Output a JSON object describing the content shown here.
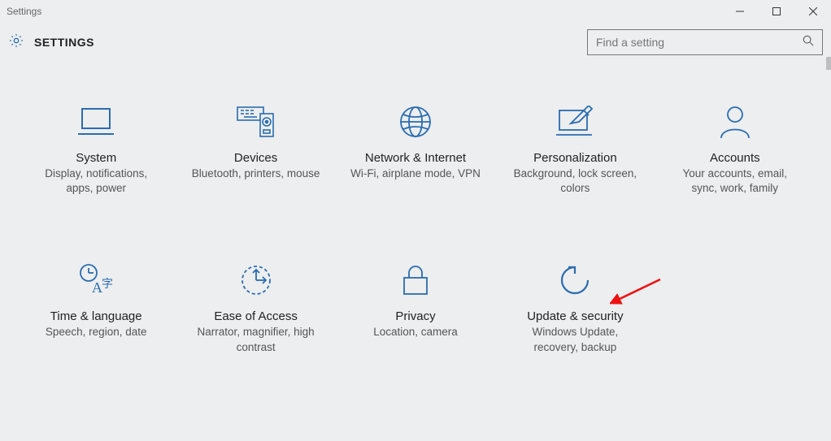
{
  "window": {
    "title": "Settings"
  },
  "header": {
    "title": "SETTINGS"
  },
  "search": {
    "placeholder": "Find a setting"
  },
  "tiles": [
    {
      "title": "System",
      "sub": "Display, notifications, apps, power"
    },
    {
      "title": "Devices",
      "sub": "Bluetooth, printers, mouse"
    },
    {
      "title": "Network & Internet",
      "sub": "Wi-Fi, airplane mode, VPN"
    },
    {
      "title": "Personalization",
      "sub": "Background, lock screen, colors"
    },
    {
      "title": "Accounts",
      "sub": "Your accounts, email, sync, work, family"
    },
    {
      "title": "Time & language",
      "sub": "Speech, region, date"
    },
    {
      "title": "Ease of Access",
      "sub": "Narrator, magnifier, high contrast"
    },
    {
      "title": "Privacy",
      "sub": "Location, camera"
    },
    {
      "title": "Update & security",
      "sub": "Windows Update, recovery, backup"
    }
  ]
}
